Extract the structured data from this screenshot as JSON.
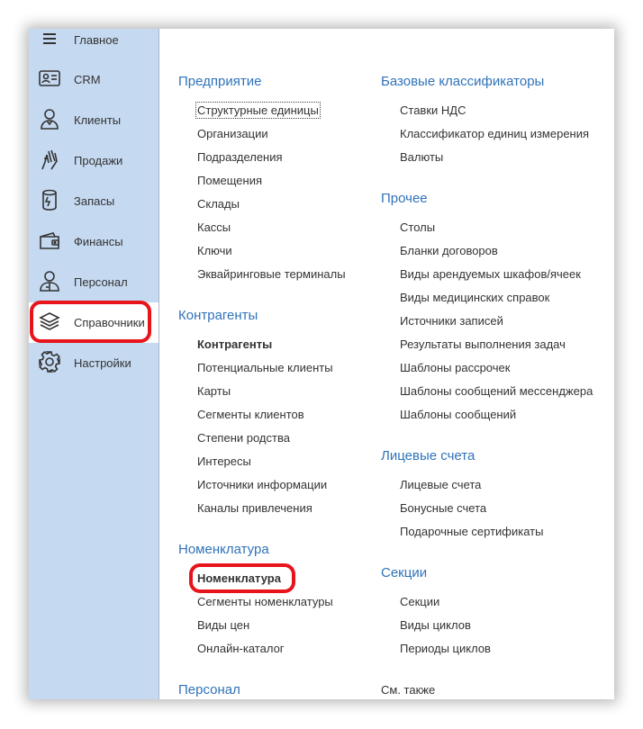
{
  "colors": {
    "sidebar_bg": "#c5d9f1",
    "section_title": "#2f73b9",
    "highlight": "#e8141c"
  },
  "sidebar": {
    "items": [
      {
        "label": "Главное",
        "icon": "menu-icon"
      },
      {
        "label": "CRM",
        "icon": "contact-card-icon"
      },
      {
        "label": "Клиенты",
        "icon": "person-icon"
      },
      {
        "label": "Продажи",
        "icon": "hand-cash-icon"
      },
      {
        "label": "Запасы",
        "icon": "storage-jar-icon"
      },
      {
        "label": "Финансы",
        "icon": "wallet-icon"
      },
      {
        "label": "Персонал",
        "icon": "employee-icon"
      },
      {
        "label": "Справочники",
        "icon": "layers-icon",
        "active": true
      },
      {
        "label": "Настройки",
        "icon": "gear-icon"
      }
    ]
  },
  "col1": {
    "enterprise": {
      "title": "Предприятие",
      "items": [
        "Структурные единицы",
        "Организации",
        "Подразделения",
        "Помещения",
        "Склады",
        "Кассы",
        "Ключи",
        "Эквайринговые терминалы"
      ]
    },
    "counterparties": {
      "title": "Контрагенты",
      "items": [
        "Контрагенты",
        "Потенциальные клиенты",
        "Карты",
        "Сегменты клиентов",
        "Степени родства",
        "Интересы",
        "Источники информации",
        "Каналы привлечения"
      ]
    },
    "nomenclature": {
      "title": "Номенклатура",
      "items": [
        "Номенклатура",
        "Сегменты номенклатуры",
        "Виды цен",
        "Онлайн-каталог"
      ]
    },
    "personnel": {
      "title": "Персонал"
    }
  },
  "col2": {
    "classifiers": {
      "title": "Базовые классификаторы",
      "items": [
        "Ставки НДС",
        "Классификатор единиц измерения",
        "Валюты"
      ]
    },
    "other": {
      "title": "Прочее",
      "items": [
        "Столы",
        "Бланки договоров",
        "Виды арендуемых шкафов/ячеек",
        "Виды медицинских справок",
        "Источники записей",
        "Результаты выполнения задач",
        "Шаблоны рассрочек",
        "Шаблоны сообщений мессенджера",
        "Шаблоны сообщений"
      ]
    },
    "accounts": {
      "title": "Лицевые счета",
      "items": [
        "Лицевые счета",
        "Бонусные счета",
        "Подарочные сертификаты"
      ]
    },
    "sections": {
      "title": "Секции",
      "items": [
        "Секции",
        "Виды циклов",
        "Периоды циклов"
      ]
    },
    "see_also": "См. также"
  }
}
